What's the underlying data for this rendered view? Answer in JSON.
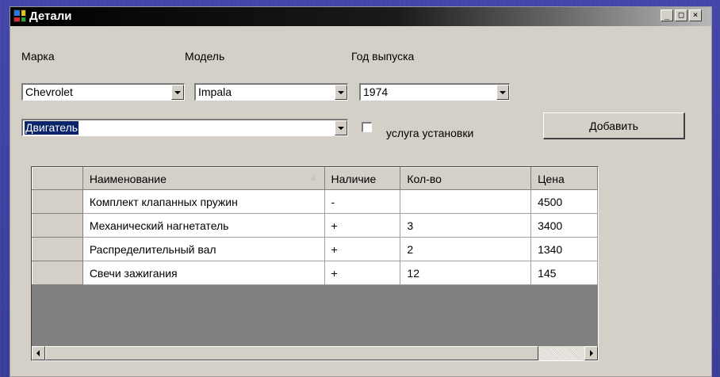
{
  "window": {
    "title": "Детали",
    "controls": {
      "minimize": "_",
      "maximize": "□",
      "close": "×"
    }
  },
  "form": {
    "make_label": "Марка",
    "model_label": "Модель",
    "year_label": "Год выпуска",
    "make_value": "Chevrolet",
    "model_value": "Impala",
    "year_value": "1974",
    "category_value": "Двигатель",
    "install_service_label": "услуга установки",
    "install_service_checked": false,
    "add_button": "Добавить"
  },
  "grid": {
    "columns": [
      "Наименование",
      "Наличие",
      "Кол-во",
      "Цена"
    ],
    "rows": [
      [
        "Комплект клапанных пружин",
        "-",
        "",
        "4500"
      ],
      [
        "Механический нагнетатель",
        "+",
        "3",
        "3400"
      ],
      [
        "Распределительный вал",
        "+",
        "2",
        "1340"
      ],
      [
        "Свечи зажигания",
        "+",
        "12",
        "145"
      ]
    ],
    "sort_column": "Наименование"
  },
  "icons": {
    "app": "app-window-icon",
    "dropdown": "chevron-down-icon",
    "sort": "sort-asc-icon",
    "scroll_left": "arrow-left-icon",
    "scroll_right": "arrow-right-icon"
  },
  "colors": {
    "window_bg": "#d4d0c8",
    "titlebar_start": "#000000",
    "titlebar_end": "#b8b8b8",
    "selection": "#0a246a",
    "desktop": "#3b3e9c",
    "grid_empty": "#808080"
  }
}
